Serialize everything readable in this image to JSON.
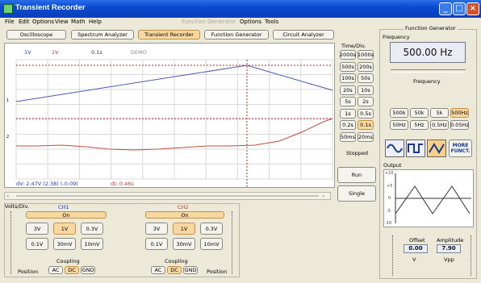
{
  "window": {
    "title": "Transient Recorder"
  },
  "menu": {
    "file": "File",
    "edit": "Edit",
    "options": "Options",
    "view": "View",
    "math": "Math",
    "help": "Help",
    "fg_title": "Function Generator",
    "fg_options": "Options",
    "fg_tools": "Tools"
  },
  "tabs": {
    "oscilloscope": "Oscilloscope",
    "spectrum": "Spectrum Analyzer",
    "transient": "Transient Recorder",
    "function_generator": "Function Generator",
    "circuit": "Circuit Analyzer"
  },
  "plot": {
    "ch1_scale": "1V",
    "ch2_scale": "1V",
    "time_scale": "0.1s",
    "mode": "DEMO",
    "marker1": "1",
    "marker2": "2",
    "dv": "dV: 2.47V  (2.38) (-0.09)",
    "dt": "dt: 0.46s"
  },
  "time_div": {
    "title": "Time/Div.",
    "buttons": [
      "2000s",
      "1000s",
      "500s",
      "200s",
      "100s",
      "50s",
      "20s",
      "10s",
      "5s",
      "2s",
      "1s",
      "0.5s",
      "0.2s",
      "0.1s",
      "50ms",
      "20ms"
    ],
    "selected": "0.1s",
    "status": "Stopped",
    "run": "Run",
    "single": "Single"
  },
  "channels": {
    "volts_div": "Volts/Div.",
    "ch1": {
      "name": "CH1",
      "on": "On",
      "scales": [
        "3V",
        "1V",
        "0.3V",
        "0.1V",
        "30mV",
        "10mV"
      ],
      "selected": "1V",
      "coupling_label": "Coupling",
      "coupling": [
        "AC",
        "DC",
        "GND"
      ],
      "coupling_selected": "DC",
      "position": "Position",
      "color": "#1a3fb5"
    },
    "ch2": {
      "name": "CH2",
      "on": "On",
      "scales": [
        "3V",
        "1V",
        "0.3V",
        "0.1V",
        "30mV",
        "10mV"
      ],
      "selected": "1V",
      "coupling_label": "Coupling",
      "coupling": [
        "AC",
        "DC",
        "GND"
      ],
      "coupling_selected": "DC",
      "position": "Position",
      "color": "#c0392b"
    }
  },
  "function_generator": {
    "title": "Function Generator",
    "frequency_label": "Frequency",
    "frequency_value": "500.00 Hz",
    "slider_label": "Frequency",
    "freq_buttons": [
      "500k",
      "50k",
      "5k",
      "500Hz",
      "50Hz",
      "5Hz",
      "0.5Hz",
      "0.05Hz"
    ],
    "freq_selected": "500Hz",
    "waveforms": [
      "sine-icon",
      "square-icon",
      "triangle-icon"
    ],
    "waveform_selected": "triangle-icon",
    "more": "MORE FUNCT.",
    "output_label": "Output",
    "output_ticks": [
      "+10",
      "+5",
      "0",
      "-5",
      "-10"
    ],
    "offset_label": "Offset",
    "offset_value": "0.00",
    "offset_unit": "V",
    "amplitude_label": "Amplitude",
    "amplitude_value": "7.90",
    "amplitude_unit": "Vpp"
  },
  "colors": {
    "ch1": "#4a5bb0",
    "ch2": "#c0503a",
    "accent": "#0a4ad0"
  }
}
